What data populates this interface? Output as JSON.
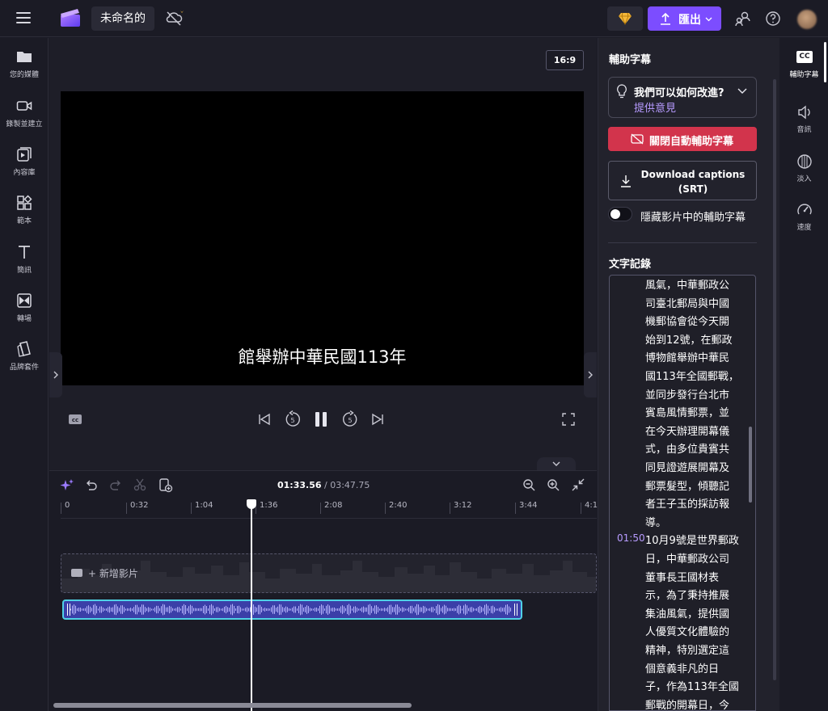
{
  "app": {
    "project_title": "未命名的",
    "export_label": "匯出"
  },
  "left_sidebar": {
    "items": [
      {
        "label": "您的媒體"
      },
      {
        "label": "錄製並建立"
      },
      {
        "label": "內容庫"
      },
      {
        "label": "範本"
      },
      {
        "label": "簡訊"
      },
      {
        "label": "轉場"
      },
      {
        "label": "品牌套件"
      }
    ]
  },
  "preview": {
    "aspect_ratio": "16:9",
    "subtitle_text": "館舉辦中華民國113年"
  },
  "timeline": {
    "current_time": "01:33.56",
    "total_time": "/ 03:47.75",
    "ticks": [
      "0",
      "0:32",
      "1:04",
      "1:36",
      "2:08",
      "2:40",
      "3:12",
      "3:44",
      "4:1"
    ],
    "add_media_label": "+ 新增影片"
  },
  "caption_panel": {
    "title": "輔助字幕",
    "feedback_question": "我們可以如何改進?",
    "feedback_link": "提供意見",
    "disable_button": "關閉自動輔助字幕",
    "download_line1": "Download captions",
    "download_line2": "(SRT)",
    "toggle_label": "隱藏影片中的輔助字幕",
    "toggle_on": false,
    "transcript_title": "文字記錄",
    "transcript_lines": [
      "風氣，中華郵政公",
      "司臺北郵局與中國",
      "機郵協會從今天開",
      "始到12號，在郵政",
      "博物館舉辦中華民",
      "國113年全國郵戰，",
      "並同步發行台北市",
      "賓島風情郵票，並",
      "在今天辦理開幕儀",
      "式，由多位貴賓共",
      "同見證遊展開幕及",
      "郵票髮型，傾聽記",
      "者王子玉的採訪報",
      "導。"
    ],
    "second_timestamp": "01:50",
    "transcript_lines_2": [
      "10月9號是世界郵政",
      "日，中華郵政公司",
      "董事長王國材表",
      "示，為了秉持推展",
      "集油風氣，提供國",
      "人優質文化體驗的",
      "精神，特別選定這",
      "個意義非凡的日",
      "子，作為113年全國",
      "郵戰的開幕日，今"
    ]
  },
  "right_rail": {
    "cc_badge": "CC",
    "items": [
      {
        "label": "輔助字幕"
      },
      {
        "label": "音訊"
      },
      {
        "label": "淡入"
      },
      {
        "label": "速度"
      }
    ]
  },
  "colors": {
    "accent": "#7c4dff",
    "danger": "#d2344c",
    "link": "#b79bff",
    "audio_border": "#4fd1e6"
  }
}
